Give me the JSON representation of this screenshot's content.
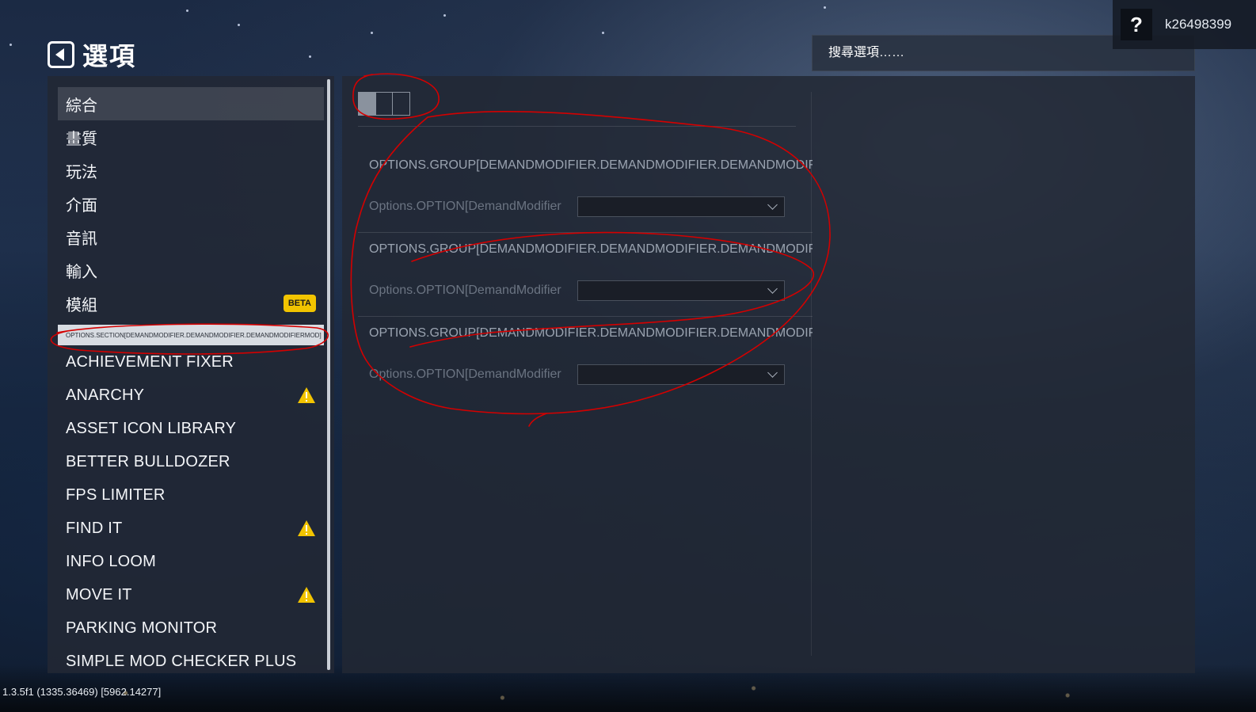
{
  "header": {
    "title": "選項",
    "back_icon": "back-arrow-icon"
  },
  "user": {
    "help_label": "?",
    "username": "k26498399"
  },
  "search": {
    "placeholder": "搜尋選項……"
  },
  "sidebar": {
    "categories": [
      {
        "label": "綜合",
        "active": true
      },
      {
        "label": "畫質"
      },
      {
        "label": "玩法"
      },
      {
        "label": "介面"
      },
      {
        "label": "音訊"
      },
      {
        "label": "輸入"
      },
      {
        "label": "模組",
        "badge": "BETA"
      }
    ],
    "section_header": "OPTIONS.SECTION[DEMANDMODIFIER.DEMANDMODIFIER.DEMANDMODIFIERMOD]",
    "mods": [
      {
        "label": "ACHIEVEMENT FIXER"
      },
      {
        "label": "ANARCHY",
        "warning": true
      },
      {
        "label": "ASSET ICON LIBRARY"
      },
      {
        "label": "BETTER BULLDOZER"
      },
      {
        "label": "FPS LIMITER"
      },
      {
        "label": "FIND IT",
        "warning": true
      },
      {
        "label": "INFO LOOM"
      },
      {
        "label": "MOVE IT",
        "warning": true
      },
      {
        "label": "PARKING MONITOR"
      },
      {
        "label": "SIMPLE MOD CHECKER PLUS"
      }
    ],
    "warning_color": "#f2c400",
    "beta_color": "#f2c400"
  },
  "content": {
    "tabs": 3,
    "active_tab": 0,
    "groups": [
      {
        "title": "OPTIONS.GROUP[DEMANDMODIFIER.DEMANDMODIFIER.DEMANDMODIFIERMOD]",
        "option_label": "Options.OPTION[DemandModifier",
        "dropdown_value": ""
      },
      {
        "title": "OPTIONS.GROUP[DEMANDMODIFIER.DEMANDMODIFIER.DEMANDMODIFIERMOD]",
        "option_label": "Options.OPTION[DemandModifier",
        "dropdown_value": ""
      },
      {
        "title": "OPTIONS.GROUP[DEMANDMODIFIER.DEMANDMODIFIER.DEMANDMODIFIERMOD]",
        "option_label": "Options.OPTION[DemandModifier",
        "dropdown_value": ""
      }
    ]
  },
  "footer": {
    "version": "1.3.5f1 (1335.36469) [5962.14277]"
  },
  "annotation_color": "#d40000"
}
